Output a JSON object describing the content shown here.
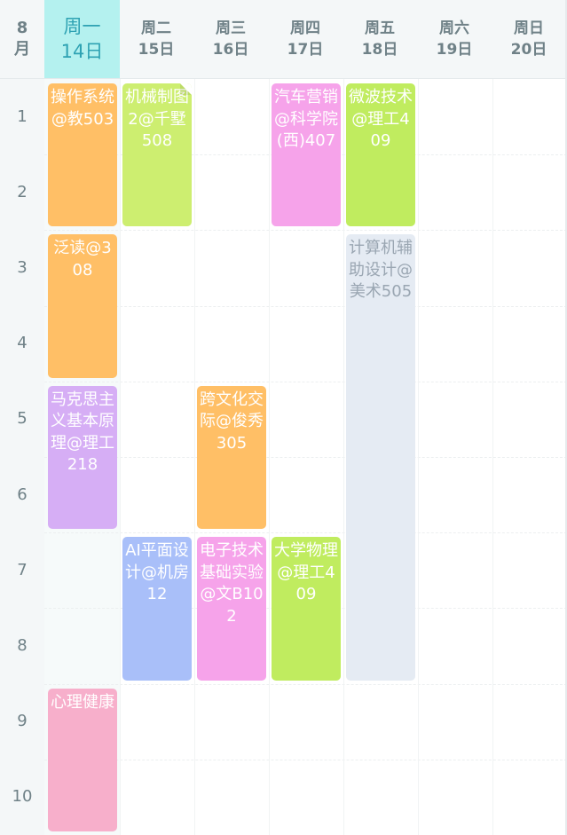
{
  "header": {
    "month_number": "8",
    "month_unit": "月",
    "days": [
      {
        "weekday": "周一",
        "date": "14日",
        "today": true
      },
      {
        "weekday": "周二",
        "date": "15日",
        "today": false
      },
      {
        "weekday": "周三",
        "date": "16日",
        "today": false
      },
      {
        "weekday": "周四",
        "date": "17日",
        "today": false
      },
      {
        "weekday": "周五",
        "date": "18日",
        "today": false
      },
      {
        "weekday": "周六",
        "date": "19日",
        "today": false
      },
      {
        "weekday": "周日",
        "date": "20日",
        "today": false
      }
    ]
  },
  "periods": [
    "1",
    "2",
    "3",
    "4",
    "5",
    "6",
    "7",
    "8",
    "9",
    "10"
  ],
  "courses": [
    {
      "day": 1,
      "start": 1,
      "span": 2,
      "text": "操作系统@教503",
      "color": "#ffbf66",
      "folded": false,
      "light_text": false
    },
    {
      "day": 1,
      "start": 3,
      "span": 2,
      "text": "泛读@308",
      "color": "#ffbf66",
      "folded": false,
      "light_text": false
    },
    {
      "day": 1,
      "start": 5,
      "span": 2,
      "text": "马克思主义基本原理@理工218",
      "color": "#d6aef5",
      "folded": false,
      "light_text": false
    },
    {
      "day": 1,
      "start": 9,
      "span": 2,
      "text": "心理健康",
      "color": "#f7afcb",
      "folded": false,
      "light_text": false
    },
    {
      "day": 2,
      "start": 1,
      "span": 2,
      "text": "机械制图2@千墅508",
      "color": "#cdee70",
      "folded": true,
      "light_text": false
    },
    {
      "day": 2,
      "start": 7,
      "span": 2,
      "text": "AI平面设计@机房12",
      "color": "#a9bff9",
      "folded": false,
      "light_text": false
    },
    {
      "day": 3,
      "start": 5,
      "span": 2,
      "text": "跨文化交际@俊秀305",
      "color": "#ffbf66",
      "folded": false,
      "light_text": false
    },
    {
      "day": 3,
      "start": 7,
      "span": 2,
      "text": "电子技术基础实验@文B102",
      "color": "#f6a3ea",
      "folded": false,
      "light_text": false
    },
    {
      "day": 4,
      "start": 1,
      "span": 2,
      "text": "汽车营销@科学院(西)407",
      "color": "#f6a3ea",
      "folded": false,
      "light_text": false
    },
    {
      "day": 4,
      "start": 7,
      "span": 2,
      "text": "大学物理@理工409",
      "color": "#c0ec5f",
      "folded": false,
      "light_text": false
    },
    {
      "day": 5,
      "start": 1,
      "span": 2,
      "text": "微波技术@理工409",
      "color": "#c0ec5f",
      "folded": false,
      "light_text": false
    },
    {
      "day": 5,
      "start": 3,
      "span": 6,
      "text": "计算机辅助设计@美术505",
      "color": "#e5ebf3",
      "folded": false,
      "light_text": true
    }
  ]
}
